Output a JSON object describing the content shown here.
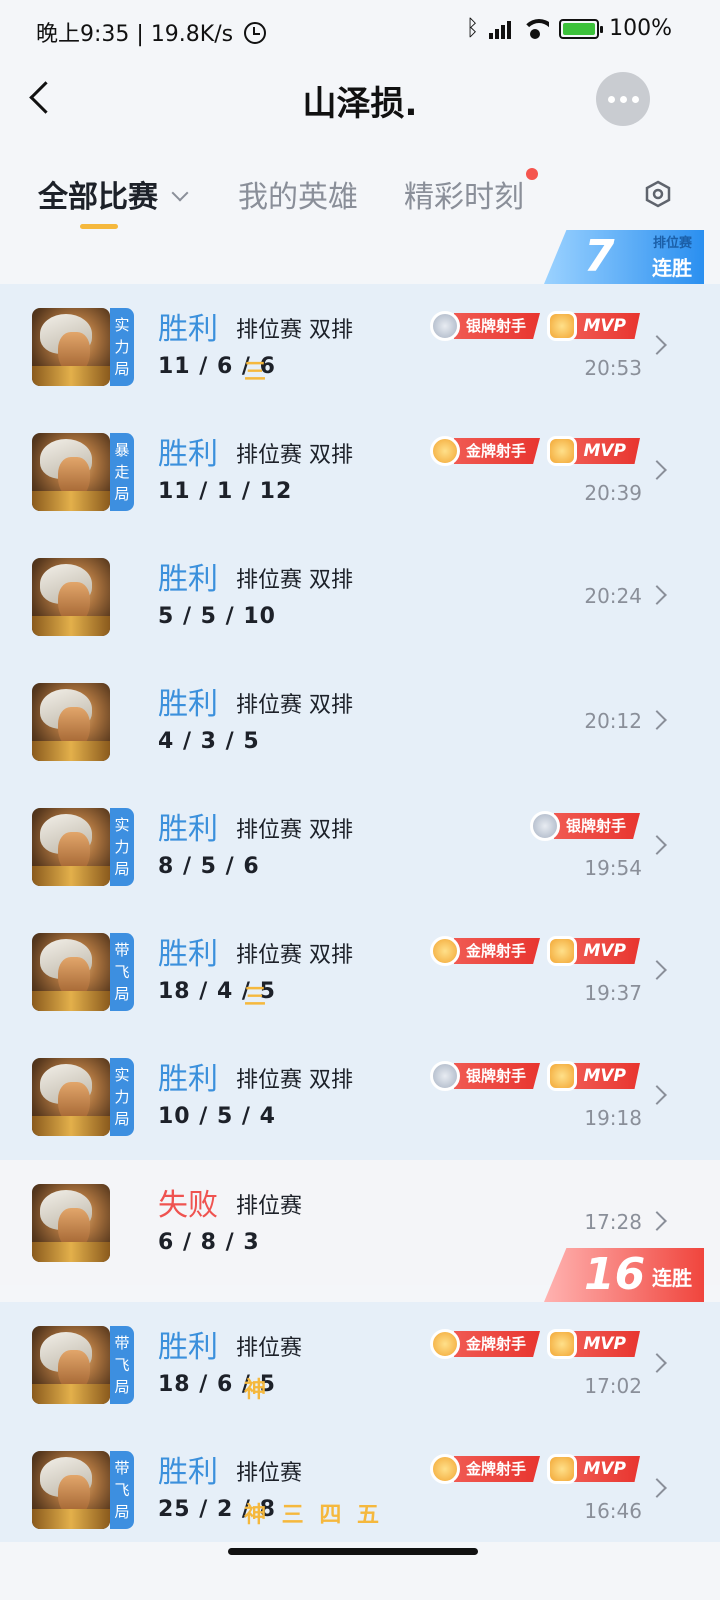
{
  "status_bar": {
    "time": "晚上9:35",
    "net_speed": "19.8K/s",
    "battery": "100%",
    "battery_level": 1.0
  },
  "nav": {
    "title": "山泽损."
  },
  "tabs": [
    {
      "label": "全部比赛",
      "active": true
    },
    {
      "label": "我的英雄",
      "active": false
    },
    {
      "label": "精彩时刻",
      "active": false,
      "has_dot": true
    }
  ],
  "streaks": [
    {
      "number": "7",
      "small": "排位赛",
      "big": "连胜",
      "type": "win"
    },
    {
      "number": "16",
      "small": "",
      "big": "连胜",
      "type": "loss"
    }
  ],
  "matches": [
    {
      "result": "胜利",
      "mode": "排位赛 双排",
      "kda": "11 / 6 / 6",
      "honors": "三",
      "tag": [
        "实",
        "力",
        "局"
      ],
      "badges": [
        "银牌射手",
        "MVP"
      ],
      "time": "20:53"
    },
    {
      "result": "胜利",
      "mode": "排位赛 双排",
      "kda": "11 / 1 / 12",
      "honors": "",
      "tag": [
        "暴",
        "走",
        "局"
      ],
      "badges": [
        "金牌射手",
        "MVP"
      ],
      "time": "20:39"
    },
    {
      "result": "胜利",
      "mode": "排位赛 双排",
      "kda": "5 / 5 / 10",
      "honors": "",
      "tag": [],
      "badges": [],
      "time": "20:24"
    },
    {
      "result": "胜利",
      "mode": "排位赛 双排",
      "kda": "4 / 3 / 5",
      "honors": "",
      "tag": [],
      "badges": [],
      "time": "20:12"
    },
    {
      "result": "胜利",
      "mode": "排位赛 双排",
      "kda": "8 / 5 / 6",
      "honors": "",
      "tag": [
        "实",
        "力",
        "局"
      ],
      "badges": [
        "银牌射手"
      ],
      "time": "19:54"
    },
    {
      "result": "胜利",
      "mode": "排位赛 双排",
      "kda": "18 / 4 / 5",
      "honors": "三",
      "tag": [
        "带",
        "飞",
        "局"
      ],
      "badges": [
        "金牌射手",
        "MVP"
      ],
      "time": "19:37"
    },
    {
      "result": "胜利",
      "mode": "排位赛 双排",
      "kda": "10 / 5 / 4",
      "honors": "",
      "tag": [
        "实",
        "力",
        "局"
      ],
      "badges": [
        "银牌射手",
        "MVP"
      ],
      "time": "19:18"
    },
    {
      "result": "失败",
      "mode": "排位赛",
      "kda": "6 / 8 / 3",
      "honors": "",
      "tag": [],
      "badges": [],
      "time": "17:28"
    },
    {
      "result": "胜利",
      "mode": "排位赛",
      "kda": "18 / 6 / 5",
      "honors": "神",
      "tag": [
        "带",
        "飞",
        "局"
      ],
      "badges": [
        "金牌射手",
        "MVP"
      ],
      "time": "17:02"
    },
    {
      "result": "胜利",
      "mode": "排位赛",
      "kda": "25 / 2 / 8",
      "honors": "神 三 四 五",
      "tag": [
        "带",
        "飞",
        "局"
      ],
      "badges": [
        "金牌射手",
        "MVP"
      ],
      "time": "16:46"
    }
  ],
  "colors": {
    "win": "#3b90dc",
    "loss": "#ef5350",
    "accent": "#f5b83d",
    "badge_red": "#e8352f"
  }
}
